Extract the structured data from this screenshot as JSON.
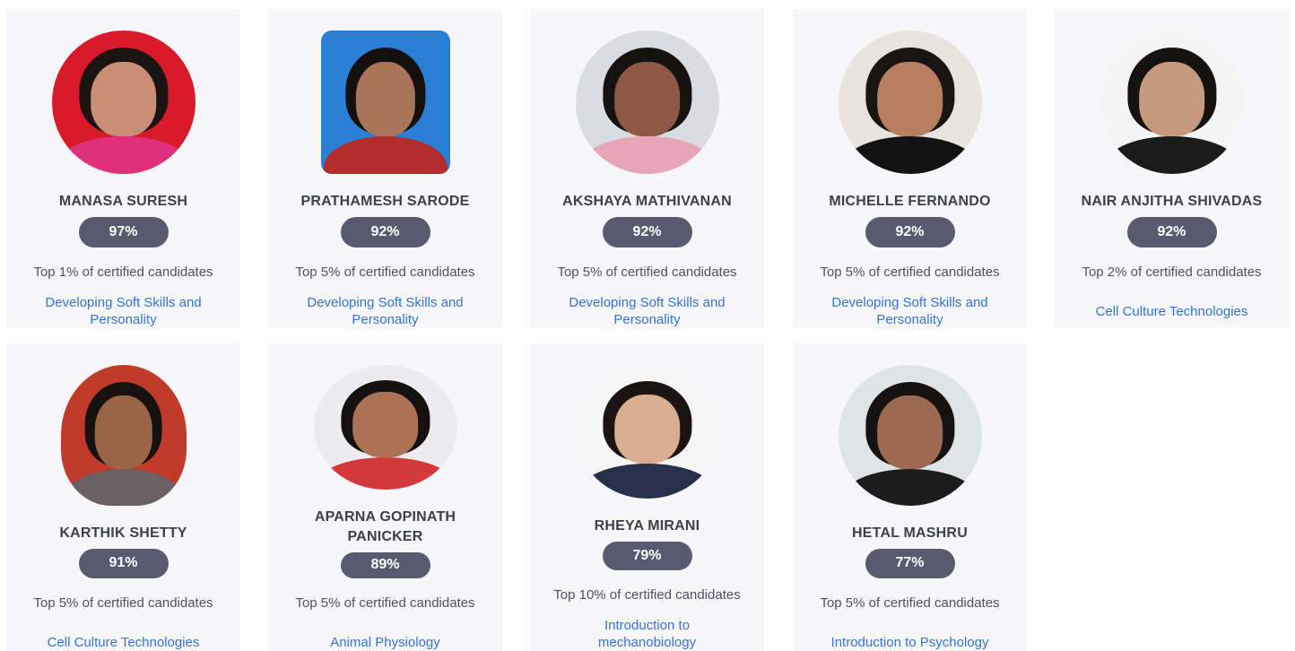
{
  "cards": [
    {
      "name": "MANASA SURESH",
      "score": "97%",
      "rank": "Top 1% of certified candidates",
      "course": "Developing Soft Skills and Personality",
      "photo": {
        "bg": "#d91a2a",
        "hair": "#1b1412",
        "skin": "#c98f76",
        "shirt": "#e0307c"
      }
    },
    {
      "name": "PRATHAMESH SARODE",
      "score": "92%",
      "rank": "Top 5% of certified candidates",
      "course": "Developing Soft Skills and Personality",
      "photo": {
        "bg": "#2a7fd4",
        "hair": "#14100f",
        "skin": "#a8755b",
        "shirt": "#b52c2c"
      }
    },
    {
      "name": "AKSHAYA MATHIVANAN",
      "score": "92%",
      "rank": "Top 5% of certified candidates",
      "course": "Developing Soft Skills and Personality",
      "photo": {
        "bg": "#d9dce2",
        "hair": "#151212",
        "skin": "#8c5a44",
        "shirt": "#e6a6b8"
      }
    },
    {
      "name": "MICHELLE FERNANDO",
      "score": "92%",
      "rank": "Top 5% of certified candidates",
      "course": "Developing Soft Skills and Personality",
      "photo": {
        "bg": "#e7e5dd",
        "hair": "#1a1412",
        "skin": "#b77f5f",
        "shirt": "#121212"
      }
    },
    {
      "name": "NAIR ANJITHA SHIVADAS",
      "score": "92%",
      "rank": "Top 2% of certified candidates",
      "course": "Cell Culture Technologies",
      "photo": {
        "bg": "#f4f4f4",
        "hair": "#151212",
        "skin": "#c79a80",
        "shirt": "#1b1b1b"
      }
    },
    {
      "name": "KARTHIK SHETTY",
      "score": "91%",
      "rank": "Top 5% of certified candidates",
      "course": "Cell Culture Technologies",
      "photo": {
        "bg": "#c23a2a",
        "hair": "#171210",
        "skin": "#9a6546",
        "shirt": "#6a5f62"
      }
    },
    {
      "name": "APARNA GOPINATH PANICKER",
      "score": "89%",
      "rank": "Top 5% of certified candidates",
      "course": "Animal Physiology",
      "photo": {
        "bg": "#ececee",
        "hair": "#151111",
        "skin": "#ab7256",
        "shirt": "#d3383d"
      }
    },
    {
      "name": "RHEYA MIRANI",
      "score": "79%",
      "rank": "Top 10% of certified candidates",
      "course": "Introduction to mechanobiology",
      "photo": {
        "bg": "#f6f6f6",
        "hair": "#1a1413",
        "skin": "#d9ad92",
        "shirt": "#27304a"
      }
    },
    {
      "name": "HETAL MASHRU",
      "score": "77%",
      "rank": "Top 5% of certified candidates",
      "course": "Introduction to Psychology",
      "photo": {
        "bg": "#dfe5e6",
        "hair": "#161212",
        "skin": "#9b6a50",
        "shirt": "#1c1c1c"
      }
    }
  ]
}
